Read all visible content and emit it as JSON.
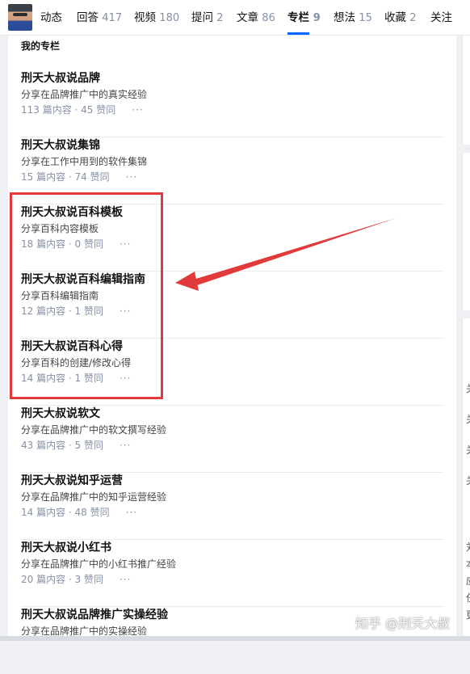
{
  "header": {
    "tabs": [
      {
        "label": "动态",
        "count": ""
      },
      {
        "label": "回答",
        "count": "417"
      },
      {
        "label": "视频",
        "count": "180"
      },
      {
        "label": "提问",
        "count": "2"
      },
      {
        "label": "文章",
        "count": "86"
      },
      {
        "label": "专栏",
        "count": "9",
        "active": true
      },
      {
        "label": "想法",
        "count": "15"
      },
      {
        "label": "收藏",
        "count": "2"
      },
      {
        "label": "关注",
        "count": ""
      }
    ]
  },
  "section": {
    "title": "我的专栏"
  },
  "columns": [
    {
      "title": "刑天大叔说品牌",
      "desc": "分享在品牌推广中的真实经验",
      "meta": "113 篇内容 · 45 赞同"
    },
    {
      "title": "刑天大叔说集锦",
      "desc": "分享在工作中用到的软件集锦",
      "meta": "15 篇内容 · 74 赞同"
    },
    {
      "title": "刑天大叔说百科模板",
      "desc": "分享百科内容模板",
      "meta": "18 篇内容 · 0 赞同"
    },
    {
      "title": "刑天大叔说百科编辑指南",
      "desc": "分享百科编辑指南",
      "meta": "12 篇内容 · 1 赞同"
    },
    {
      "title": "刑天大叔说百科心得",
      "desc": "分享百科的创建/修改心得",
      "meta": "14 篇内容 · 1 赞同"
    },
    {
      "title": "刑天大叔说软文",
      "desc": "分享在品牌推广中的软文撰写经验",
      "meta": "43 篇内容 · 5 赞同"
    },
    {
      "title": "刑天大叔说知乎运营",
      "desc": "分享在品牌推广中的知乎运营经验",
      "meta": "14 篇内容 · 48 赞同"
    },
    {
      "title": "刑天大叔说小红书",
      "desc": "分享在品牌推广中的小红书推广经验",
      "meta": "20 篇内容 · 3 赞同"
    },
    {
      "title": "刑天大叔说品牌推广实操经验",
      "desc": "分享在品牌推广中的实操经验",
      "meta": ""
    }
  ],
  "more_label": "···",
  "right_glyphs": [
    "关",
    "关",
    "关",
    "关",
    "〈",
    "刘",
    "本",
    "应",
    "任",
    "更"
  ],
  "watermark": "知乎 @刑天大叔",
  "colors": {
    "accent": "#0066ff",
    "annotation": "#e23a3a",
    "muted": "#8590a6"
  }
}
